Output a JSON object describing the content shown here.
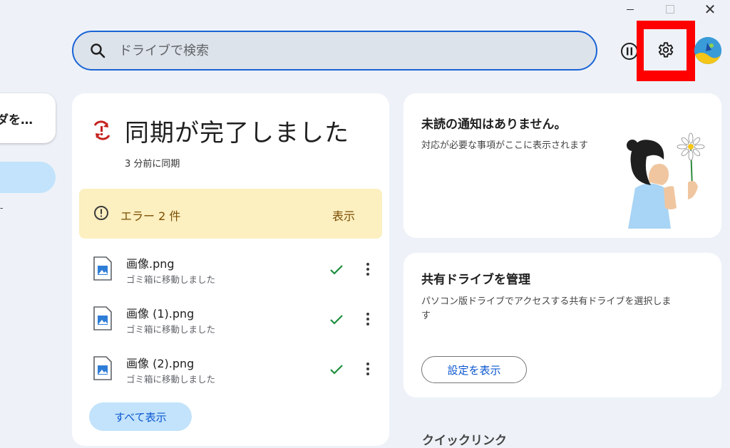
{
  "window": {
    "minimize_label": "",
    "maximize_label": "",
    "close_label": "✕"
  },
  "search": {
    "placeholder": "ドライブで検索"
  },
  "sidebar": {
    "folder_button": "ダを…",
    "tick": "-"
  },
  "sync": {
    "title": "同期が完了しました",
    "subtitle": "3 分前に同期",
    "error_text": "エラー 2 件",
    "error_action": "表示",
    "files": [
      {
        "name": "画像.png",
        "status": "ゴミ箱に移動しました"
      },
      {
        "name": "画像 (1).png",
        "status": "ゴミ箱に移動しました"
      },
      {
        "name": "画像 (2).png",
        "status": "ゴミ箱に移動しました"
      }
    ],
    "show_all": "すべて表示"
  },
  "notifications": {
    "title": "未読の通知はありません。",
    "description": "対応が必要な事項がここに表示されます"
  },
  "shared_drives": {
    "title": "共有ドライブを管理",
    "description": "パソコン版ドライブでアクセスする共有ドライブを選択します",
    "button": "設定を表示"
  },
  "quick_links": {
    "title": "クイックリンク"
  },
  "colors": {
    "accent": "#1a64d6",
    "highlight_box": "#ff0000",
    "error_bg": "#fcefc0",
    "success": "#1e8e3e"
  }
}
